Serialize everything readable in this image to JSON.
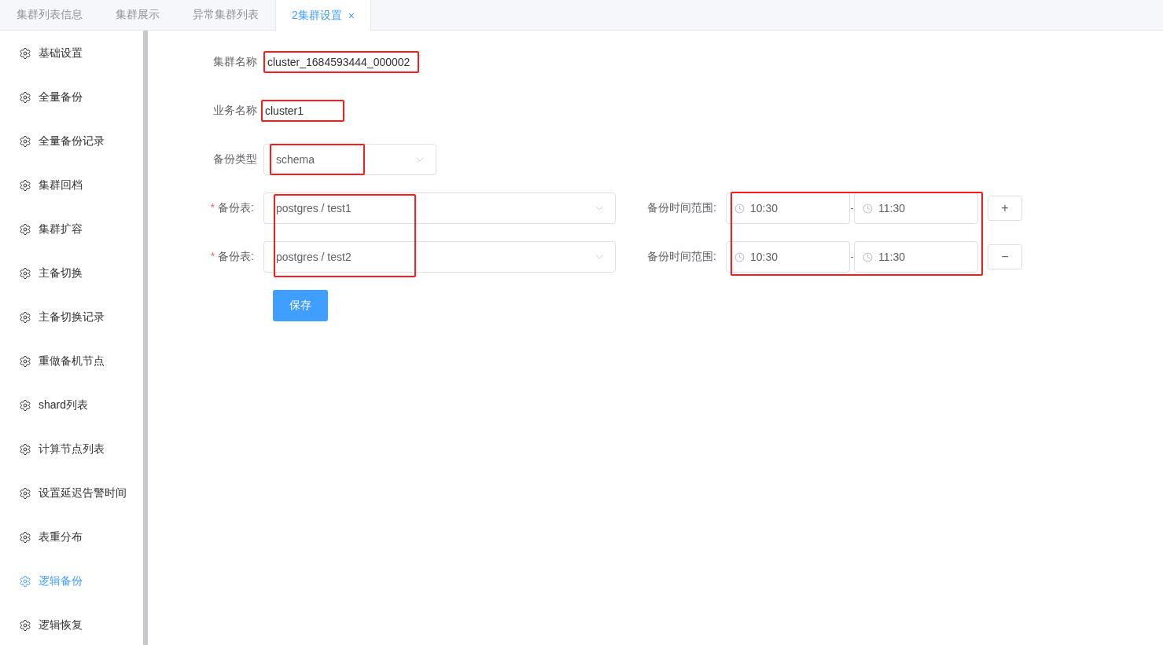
{
  "tabs": [
    {
      "label": "集群列表信息",
      "selected": false,
      "closable": false
    },
    {
      "label": "集群展示",
      "selected": false,
      "closable": false
    },
    {
      "label": "异常集群列表",
      "selected": false,
      "closable": false
    },
    {
      "label": "2集群设置",
      "selected": true,
      "closable": true
    }
  ],
  "close_glyph": "×",
  "sidebar": {
    "items": [
      {
        "label": "基础设置",
        "selected": false
      },
      {
        "label": "全量备份",
        "selected": false
      },
      {
        "label": "全量备份记录",
        "selected": false
      },
      {
        "label": "集群回档",
        "selected": false
      },
      {
        "label": "集群扩容",
        "selected": false
      },
      {
        "label": "主备切换",
        "selected": false
      },
      {
        "label": "主备切换记录",
        "selected": false
      },
      {
        "label": "重做备机节点",
        "selected": false
      },
      {
        "label": "shard列表",
        "selected": false
      },
      {
        "label": "计算节点列表",
        "selected": false
      },
      {
        "label": "设置延迟告警时间",
        "selected": false
      },
      {
        "label": "表重分布",
        "selected": false
      },
      {
        "label": "逻辑备份",
        "selected": true
      },
      {
        "label": "逻辑恢复",
        "selected": false
      }
    ]
  },
  "form": {
    "cluster_name": {
      "label": "集群名称",
      "value": "cluster_1684593444_000002"
    },
    "business_name": {
      "label": "业务名称",
      "value": "cluster1"
    },
    "backup_type": {
      "label": "备份类型",
      "value": "schema"
    },
    "backup_tables": [
      {
        "required_mark": "*",
        "label": "备份表:",
        "value": "postgres / test1",
        "time_label": "备份时间范围:",
        "start": "10:30",
        "separator": "-",
        "end": "11:30",
        "action": "+"
      },
      {
        "required_mark": "*",
        "label": "备份表:",
        "value": "postgres / test2",
        "time_label": "备份时间范围:",
        "start": "10:30",
        "separator": "-",
        "end": "11:30",
        "action": "−"
      }
    ],
    "save_button": "保存"
  }
}
